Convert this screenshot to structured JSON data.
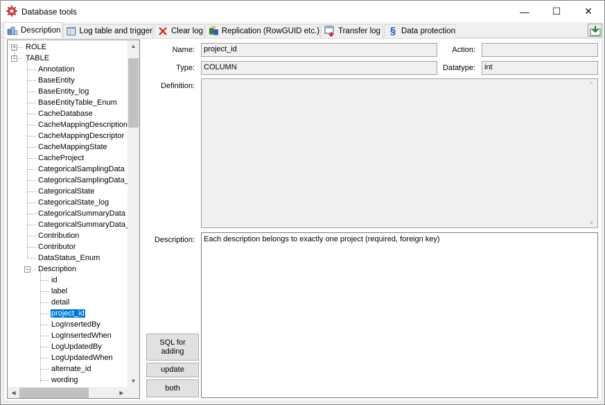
{
  "window": {
    "title": "Database tools",
    "minimize_glyph": "—",
    "maximize_glyph": "☐",
    "close_glyph": "✕"
  },
  "tabs": [
    {
      "label": "Description",
      "icon": "description-icon",
      "active": true
    },
    {
      "label": "Log table and trigger",
      "icon": "log-table-icon",
      "active": false
    },
    {
      "label": "Clear log",
      "icon": "red-x-icon",
      "active": false
    },
    {
      "label": "Replication (RowGUID etc.)",
      "icon": "replication-icon",
      "active": false
    },
    {
      "label": "Transfer log",
      "icon": "transfer-log-icon",
      "active": false
    },
    {
      "label": "Data protection",
      "icon": "section-sign-icon",
      "active": false
    }
  ],
  "tree": {
    "items": [
      {
        "label": "ROLE",
        "level": 0,
        "expander": "+"
      },
      {
        "label": "TABLE",
        "level": 0,
        "expander": "-"
      },
      {
        "label": "Annotation",
        "level": 1
      },
      {
        "label": "BaseEntity",
        "level": 1
      },
      {
        "label": "BaseEntity_log",
        "level": 1
      },
      {
        "label": "BaseEntityTable_Enum",
        "level": 1
      },
      {
        "label": "CacheDatabase",
        "level": 1
      },
      {
        "label": "CacheMappingDescription",
        "level": 1
      },
      {
        "label": "CacheMappingDescriptor",
        "level": 1
      },
      {
        "label": "CacheMappingState",
        "level": 1
      },
      {
        "label": "CacheProject",
        "level": 1
      },
      {
        "label": "CategoricalSamplingData",
        "level": 1
      },
      {
        "label": "CategoricalSamplingData_lo",
        "level": 1
      },
      {
        "label": "CategoricalState",
        "level": 1
      },
      {
        "label": "CategoricalState_log",
        "level": 1
      },
      {
        "label": "CategoricalSummaryData",
        "level": 1
      },
      {
        "label": "CategoricalSummaryData_lo",
        "level": 1
      },
      {
        "label": "Contribution",
        "level": 1
      },
      {
        "label": "Contributor",
        "level": 1
      },
      {
        "label": "DataStatus_Enum",
        "level": 1
      },
      {
        "label": "Description",
        "level": 1,
        "expander": "-"
      },
      {
        "label": "id",
        "level": 2
      },
      {
        "label": "label",
        "level": 2
      },
      {
        "label": "detail",
        "level": 2
      },
      {
        "label": "project_id",
        "level": 2,
        "selected": true
      },
      {
        "label": "LogInsertedBy",
        "level": 2
      },
      {
        "label": "LogInsertedWhen",
        "level": 2
      },
      {
        "label": "LogUpdatedBy",
        "level": 2
      },
      {
        "label": "LogUpdatedWhen",
        "level": 2
      },
      {
        "label": "alternate_id",
        "level": 2
      },
      {
        "label": "wording",
        "level": 2
      }
    ]
  },
  "form": {
    "name_label": "Name:",
    "name_value": "project_id",
    "action_label": "Action:",
    "action_value": "",
    "type_label": "Type:",
    "type_value": "COLUMN",
    "datatype_label": "Datatype:",
    "datatype_value": "int",
    "definition_label": "Definition:",
    "definition_value": "",
    "description_label": "Description:",
    "description_value": "Each description belongs to exactly one project (required, foreign key)"
  },
  "buttons": {
    "sql_for_adding": "SQL for adding",
    "update": "update",
    "both": "both"
  },
  "colors": {
    "selection": "#0078d7",
    "window_bg": "#f0f0f0"
  }
}
